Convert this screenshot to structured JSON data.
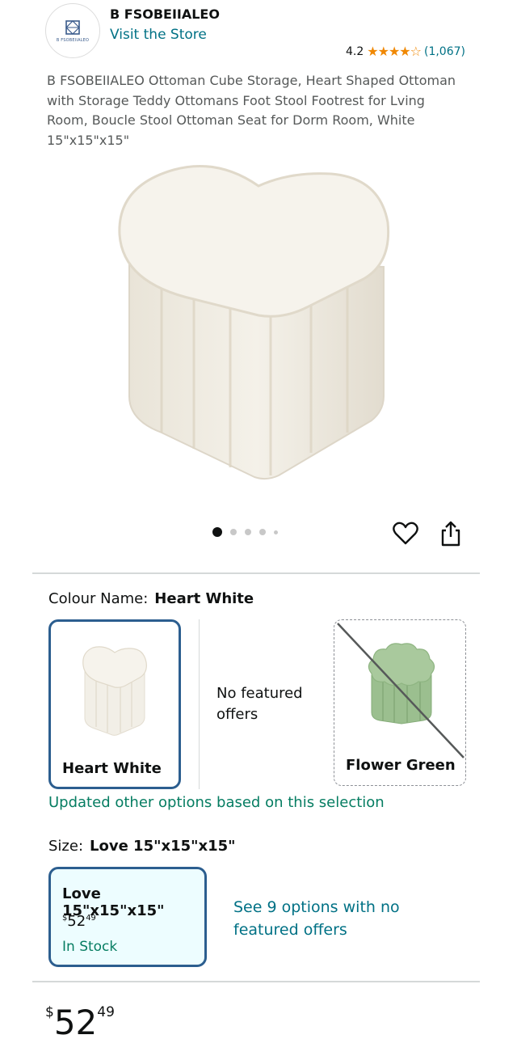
{
  "store": {
    "logo_label": "B FSOBEIIALEO",
    "brand_name": "B FSOBEIIALEO",
    "visit_link": "Visit the Store"
  },
  "rating": {
    "value": "4.2",
    "stars": "★★★★☆",
    "count": "(1,067)"
  },
  "product": {
    "title": "B FSOBEIIALEO Ottoman Cube Storage, Heart Shaped Ottoman with Storage Teddy Ottomans Foot Stool Footrest for Lving Room, Boucle Stool Ottoman Seat for Dorm Room, White 15\"x15\"x15\""
  },
  "gallery": {
    "image_count": 5,
    "active_index": 0
  },
  "colour": {
    "label": "Colour Name:",
    "selected": "Heart White",
    "options": [
      {
        "name": "Heart White",
        "selected": true,
        "available": true
      },
      {
        "name": "Flower Green",
        "selected": false,
        "available": false
      }
    ],
    "no_offers_text": "No featured offers",
    "updated_message": "Updated other options based on this selection"
  },
  "size": {
    "label": "Size:",
    "selected": "Love 15\"x15\"x15\"",
    "card": {
      "name": "Love 15\"x15\"x15\"",
      "currency": "$",
      "price_whole": "52",
      "price_fraction": "49",
      "stock": "In Stock"
    },
    "see_options": "See 9 options with no featured offers"
  },
  "price": {
    "currency": "$",
    "whole": "52",
    "fraction": "49"
  },
  "colors": {
    "link": "#007185",
    "star": "#f08804",
    "success": "#067d62",
    "selected_border": "#2c5e8f",
    "selected_bg": "#edfdff"
  }
}
